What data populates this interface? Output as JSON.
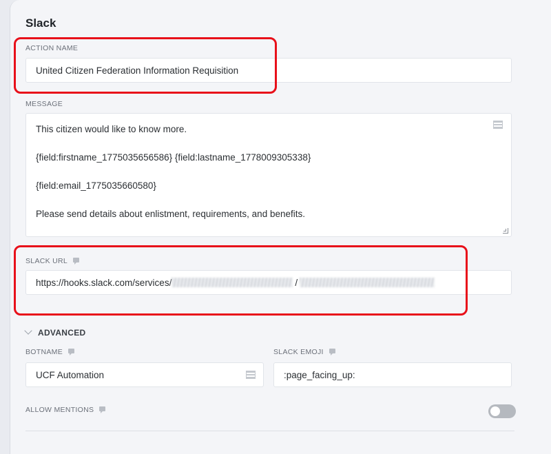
{
  "section_title": "Slack",
  "action_name": {
    "label": "ACTION NAME",
    "value": "United Citizen Federation Information Requisition"
  },
  "message": {
    "label": "MESSAGE",
    "lines": [
      "This citizen would like to know more.",
      "{field:firstname_1775035656586} {field:lastname_1778009305338}",
      "{field:email_1775035660580}",
      "Please send details about enlistment, requirements, and benefits."
    ]
  },
  "slack_url": {
    "label": "SLACK URL",
    "value_prefix": "https://hooks.slack.com/services/",
    "separator": "/"
  },
  "advanced": {
    "label": "ADVANCED",
    "expanded": true
  },
  "botname": {
    "label": "BOTNAME",
    "value": "UCF Automation"
  },
  "slack_emoji": {
    "label": "SLACK EMOJI",
    "value": ":page_facing_up:"
  },
  "allow_mentions": {
    "label": "ALLOW MENTIONS",
    "enabled": false
  },
  "colors": {
    "highlight": "#e8101a",
    "toggle_off": "#b5b9bf"
  },
  "icons": {
    "help": "help-bubble-icon",
    "field_options": "list-lines-icon",
    "collapse": "chevron-down-icon"
  }
}
